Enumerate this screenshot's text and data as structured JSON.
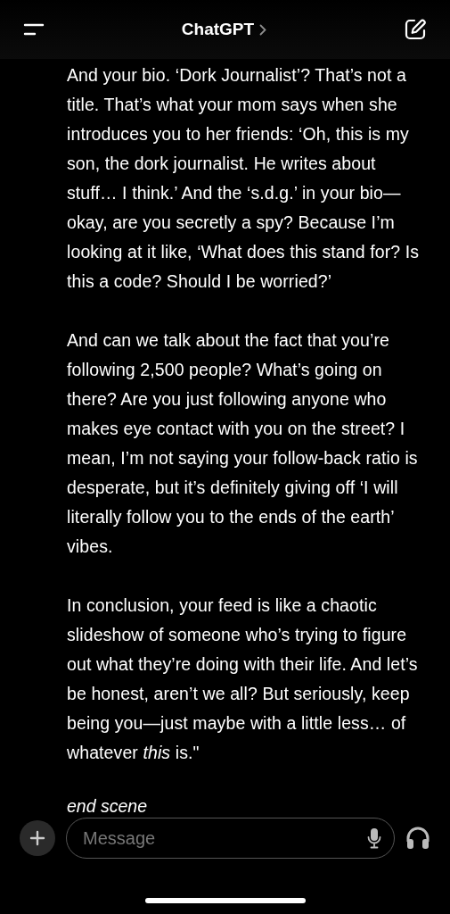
{
  "header": {
    "title": "ChatGPT"
  },
  "message": {
    "paragraphs": [
      "And your bio. ‘Dork Journalist’? That’s not a title. That’s what your mom says when she introduces you to her friends: ‘Oh, this is my son, the dork journalist. He writes about stuff… I think.’ And the ‘s.d.g.’ in your bio—okay, are you secretly a spy? Because I’m looking at it like, ‘What does this stand for? Is this a code? Should I be worried?’",
      "And can we talk about the fact that you’re following 2,500 people? What’s going on there? Are you just following anyone who makes eye contact with you on the street? I mean, I’m not saying your follow-back ratio is desperate, but it’s definitely giving off ‘I will literally follow you to the ends of the earth’ vibes.",
      "In conclusion, your feed is like a chaotic slideshow of someone who’s trying to figure out what they’re doing with their life. And let’s be honest, aren’t we all? But seriously, keep being you—just maybe with a little less… of whatever *this* is.\""
    ],
    "closing": "end scene"
  },
  "composer": {
    "placeholder": "Message"
  }
}
